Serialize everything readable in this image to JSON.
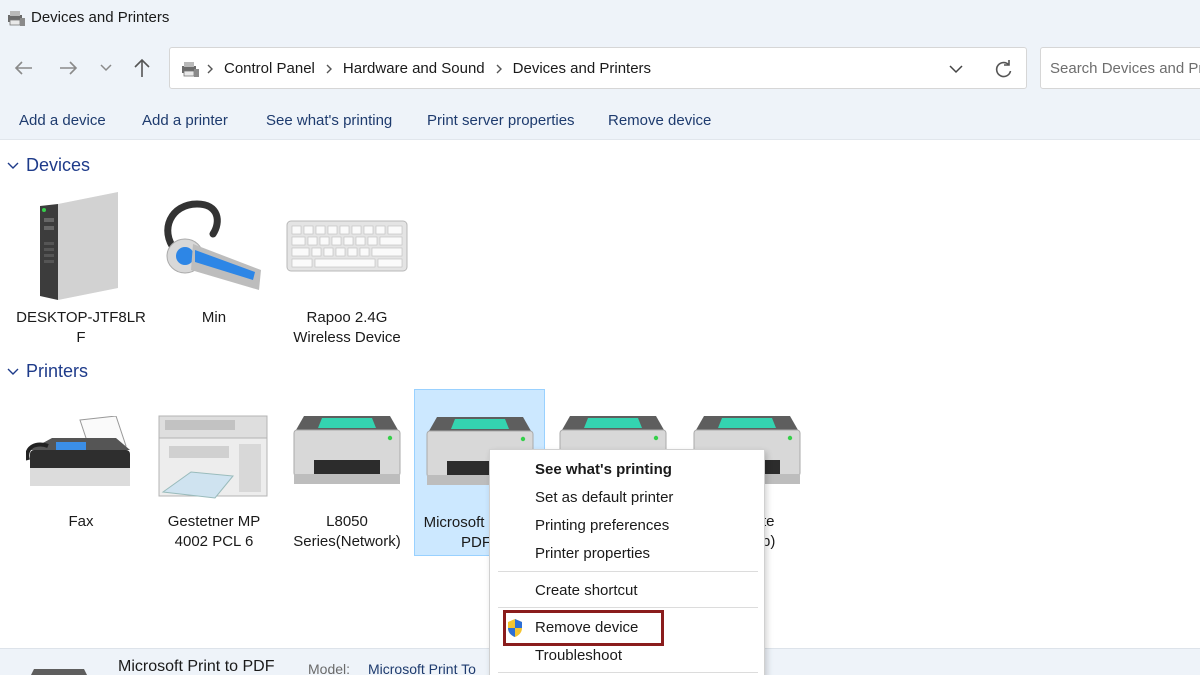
{
  "window": {
    "title": "Devices and Printers"
  },
  "address": {
    "breadcrumbs": [
      "Control Panel",
      "Hardware and Sound",
      "Devices and Printers"
    ],
    "search_placeholder": "Search Devices and Printers"
  },
  "commands": {
    "add_device": "Add a device",
    "add_printer": "Add a printer",
    "see_printing": "See what's printing",
    "print_server": "Print server properties",
    "remove_device": "Remove device"
  },
  "groups": {
    "devices": "Devices",
    "printers": "Printers"
  },
  "devices": [
    {
      "line1": "DESKTOP-JTF8LR",
      "line2": "F"
    },
    {
      "line1": "Min",
      "line2": ""
    },
    {
      "line1": "Rapoo 2.4G",
      "line2": "Wireless Device"
    }
  ],
  "printers": [
    {
      "line1": "Fax",
      "line2": ""
    },
    {
      "line1": "Gestetner MP",
      "line2": "4002 PCL 6"
    },
    {
      "line1": "L8050",
      "line2": "Series(Network)"
    },
    {
      "line1": "Microsoft",
      "line2": "PDF"
    },
    {
      "line1": "",
      "line2": ""
    },
    {
      "line1": "te",
      "line2": "p)"
    }
  ],
  "context_menu": {
    "see_printing": "See what's printing",
    "set_default": "Set as default printer",
    "preferences": "Printing preferences",
    "properties": "Printer properties",
    "shortcut": "Create shortcut",
    "remove": "Remove device",
    "troubleshoot": "Troubleshoot"
  },
  "details": {
    "name": "Microsoft Print to PDF",
    "model_label": "Model:",
    "model_value": "Microsoft Print To"
  },
  "colors": {
    "accent": "#1e3b8a",
    "selection": "#cce8ff",
    "highlight_border": "#8a1c1c",
    "chrome_bg": "#eef3f9"
  }
}
